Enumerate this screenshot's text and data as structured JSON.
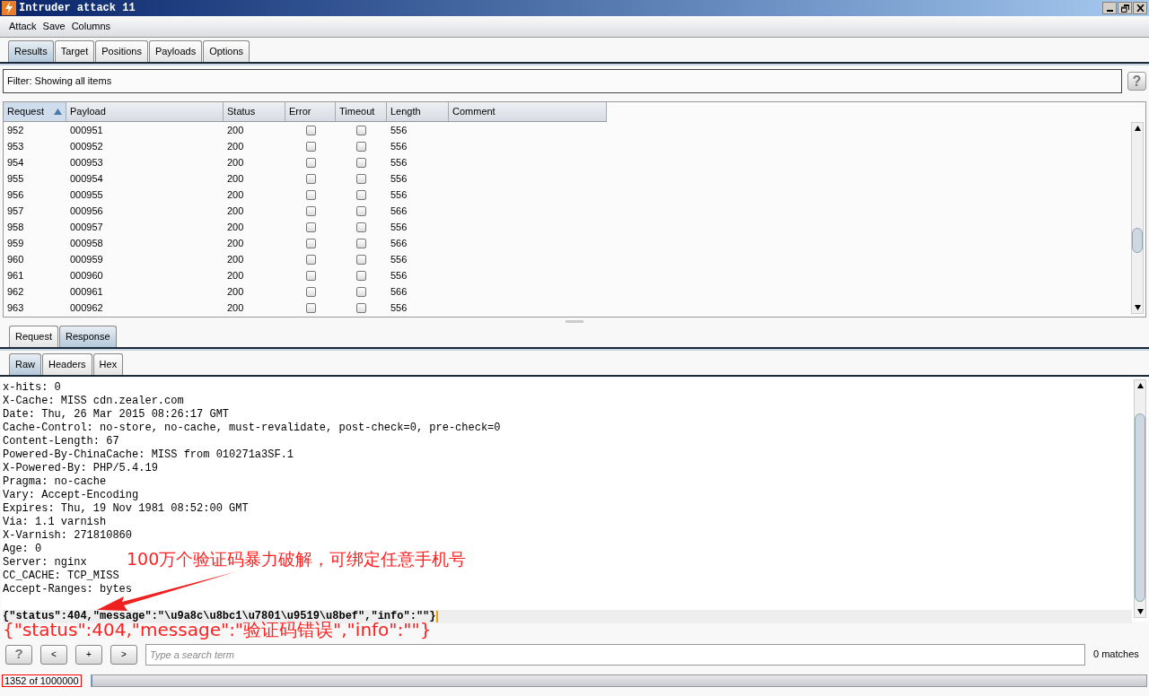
{
  "window": {
    "title": "Intruder attack 11"
  },
  "menu": [
    "Attack",
    "Save",
    "Columns"
  ],
  "tabs": [
    {
      "label": "Results",
      "selected": true
    },
    {
      "label": "Target",
      "selected": false
    },
    {
      "label": "Positions",
      "selected": false
    },
    {
      "label": "Payloads",
      "selected": false
    },
    {
      "label": "Options",
      "selected": false
    }
  ],
  "filter": {
    "text": "Filter:  Showing all items",
    "help": "?"
  },
  "table": {
    "columns": [
      {
        "label": "Request",
        "sorted": true
      },
      {
        "label": "Payload",
        "sorted": false
      },
      {
        "label": "Status",
        "sorted": false
      },
      {
        "label": "Error",
        "sorted": false
      },
      {
        "label": "Timeout",
        "sorted": false
      },
      {
        "label": "Length",
        "sorted": false
      },
      {
        "label": "Comment",
        "sorted": false
      }
    ],
    "rows": [
      {
        "request": "952",
        "payload": "000951",
        "status": "200",
        "error": false,
        "timeout": false,
        "length": "556"
      },
      {
        "request": "953",
        "payload": "000952",
        "status": "200",
        "error": false,
        "timeout": false,
        "length": "556"
      },
      {
        "request": "954",
        "payload": "000953",
        "status": "200",
        "error": false,
        "timeout": false,
        "length": "556"
      },
      {
        "request": "955",
        "payload": "000954",
        "status": "200",
        "error": false,
        "timeout": false,
        "length": "556"
      },
      {
        "request": "956",
        "payload": "000955",
        "status": "200",
        "error": false,
        "timeout": false,
        "length": "556"
      },
      {
        "request": "957",
        "payload": "000956",
        "status": "200",
        "error": false,
        "timeout": false,
        "length": "566"
      },
      {
        "request": "958",
        "payload": "000957",
        "status": "200",
        "error": false,
        "timeout": false,
        "length": "556"
      },
      {
        "request": "959",
        "payload": "000958",
        "status": "200",
        "error": false,
        "timeout": false,
        "length": "566"
      },
      {
        "request": "960",
        "payload": "000959",
        "status": "200",
        "error": false,
        "timeout": false,
        "length": "556"
      },
      {
        "request": "961",
        "payload": "000960",
        "status": "200",
        "error": false,
        "timeout": false,
        "length": "556"
      },
      {
        "request": "962",
        "payload": "000961",
        "status": "200",
        "error": false,
        "timeout": false,
        "length": "566"
      },
      {
        "request": "963",
        "payload": "000962",
        "status": "200",
        "error": false,
        "timeout": false,
        "length": "556"
      }
    ]
  },
  "message_tabs": [
    {
      "label": "Request",
      "selected": false
    },
    {
      "label": "Response",
      "selected": true
    }
  ],
  "view_tabs": [
    {
      "label": "Raw",
      "selected": true
    },
    {
      "label": "Headers",
      "selected": false
    },
    {
      "label": "Hex",
      "selected": false
    }
  ],
  "response_lines": [
    "x-hits: 0",
    "X-Cache: MISS cdn.zealer.com",
    "Date: Thu, 26 Mar 2015 08:26:17 GMT",
    "Cache-Control: no-store, no-cache, must-revalidate, post-check=0, pre-check=0",
    "Content-Length: 67",
    "Powered-By-ChinaCache: MISS from 010271a3SF.1",
    "X-Powered-By: PHP/5.4.19",
    "Pragma: no-cache",
    "Vary: Accept-Encoding",
    "Expires: Thu, 19 Nov 1981 08:52:00 GMT",
    "Via: 1.1 varnish",
    "X-Varnish: 271810860",
    "Age: 0",
    "Server: nginx",
    "CC_CACHE: TCP_MISS",
    "Accept-Ranges: bytes"
  ],
  "response_body": "{\"status\":404,\"message\":\"\\u9a8c\\u8bc1\\u7801\\u9519\\u8bef\",\"info\":\"\"}",
  "annotations": {
    "note": "100万个验证码暴力破解，可绑定任意手机号",
    "translation": "{\"status\":404,\"message\":\"验证码错误\",\"info\":\"\"}"
  },
  "search": {
    "buttons": [
      "?",
      "<",
      "+",
      ">"
    ],
    "placeholder": "Type a search term",
    "matches": "0 matches"
  },
  "status_bar": {
    "progress": "1352 of 1000000",
    "level": 0.001352
  }
}
